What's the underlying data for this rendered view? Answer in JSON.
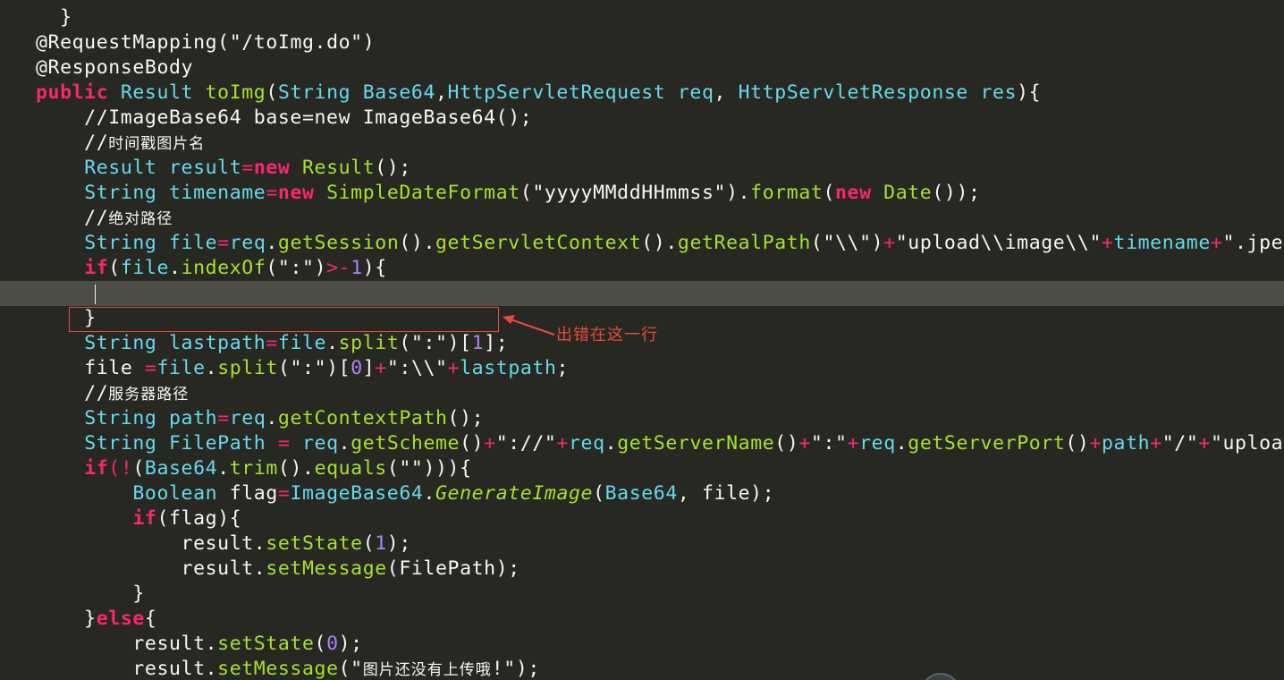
{
  "lines": [
    [
      {
        "t": "  }",
        "c": "text"
      }
    ],
    [
      {
        "t": "@RequestMapping(",
        "c": "text"
      },
      {
        "t": "\"/toImg.do\"",
        "c": "text"
      },
      {
        "t": ")",
        "c": "text"
      }
    ],
    [
      {
        "t": "@ResponseBody",
        "c": "text"
      }
    ],
    [
      {
        "t": "public",
        "c": "kw"
      },
      {
        "t": " ",
        "c": "text"
      },
      {
        "t": "Result",
        "c": "type"
      },
      {
        "t": " ",
        "c": "text"
      },
      {
        "t": "toImg",
        "c": "fn"
      },
      {
        "t": "(",
        "c": "text"
      },
      {
        "t": "String",
        "c": "type"
      },
      {
        "t": " ",
        "c": "text"
      },
      {
        "t": "Base64",
        "c": "type"
      },
      {
        "t": ",",
        "c": "text"
      },
      {
        "t": "HttpServletRequest",
        "c": "type"
      },
      {
        "t": " ",
        "c": "text"
      },
      {
        "t": "req",
        "c": "type"
      },
      {
        "t": ", ",
        "c": "text"
      },
      {
        "t": "HttpServletResponse",
        "c": "type"
      },
      {
        "t": " ",
        "c": "text"
      },
      {
        "t": "res",
        "c": "type"
      },
      {
        "t": "){",
        "c": "text"
      }
    ],
    [
      {
        "t": "    //ImageBase64 base=new ImageBase64();",
        "c": "comment"
      }
    ],
    [
      {
        "t": "    //",
        "c": "comment"
      },
      {
        "t": "时间戳图片名",
        "c": "comment",
        "cjk": true
      }
    ],
    [
      {
        "t": "    ",
        "c": "text"
      },
      {
        "t": "Result",
        "c": "type"
      },
      {
        "t": " ",
        "c": "text"
      },
      {
        "t": "result",
        "c": "type"
      },
      {
        "t": "=",
        "c": "op"
      },
      {
        "t": "new",
        "c": "kw"
      },
      {
        "t": " ",
        "c": "text"
      },
      {
        "t": "Result",
        "c": "fn"
      },
      {
        "t": "();",
        "c": "text"
      }
    ],
    [
      {
        "t": "    ",
        "c": "text"
      },
      {
        "t": "String",
        "c": "type"
      },
      {
        "t": " ",
        "c": "text"
      },
      {
        "t": "timename",
        "c": "type"
      },
      {
        "t": "=",
        "c": "op"
      },
      {
        "t": "new",
        "c": "kw"
      },
      {
        "t": " ",
        "c": "text"
      },
      {
        "t": "SimpleDateFormat",
        "c": "fn"
      },
      {
        "t": "(",
        "c": "text"
      },
      {
        "t": "\"yyyyMMddHHmmss\"",
        "c": "text"
      },
      {
        "t": ").",
        "c": "text"
      },
      {
        "t": "format",
        "c": "fn"
      },
      {
        "t": "(",
        "c": "text"
      },
      {
        "t": "new",
        "c": "kw"
      },
      {
        "t": " ",
        "c": "text"
      },
      {
        "t": "Date",
        "c": "fn"
      },
      {
        "t": "());",
        "c": "text"
      }
    ],
    [
      {
        "t": "    //",
        "c": "comment"
      },
      {
        "t": "绝对路径",
        "c": "comment",
        "cjk": true
      }
    ],
    [
      {
        "t": "    ",
        "c": "text"
      },
      {
        "t": "String",
        "c": "type"
      },
      {
        "t": " ",
        "c": "text"
      },
      {
        "t": "file",
        "c": "type"
      },
      {
        "t": "=",
        "c": "op"
      },
      {
        "t": "req",
        "c": "type"
      },
      {
        "t": ".",
        "c": "text"
      },
      {
        "t": "getSession",
        "c": "fn"
      },
      {
        "t": "().",
        "c": "text"
      },
      {
        "t": "getServletContext",
        "c": "fn"
      },
      {
        "t": "().",
        "c": "text"
      },
      {
        "t": "getRealPath",
        "c": "fn"
      },
      {
        "t": "(",
        "c": "text"
      },
      {
        "t": "\"\\\\\"",
        "c": "text"
      },
      {
        "t": ")",
        "c": "text"
      },
      {
        "t": "+",
        "c": "op"
      },
      {
        "t": "\"upload\\\\image\\\\\"",
        "c": "text"
      },
      {
        "t": "+",
        "c": "op"
      },
      {
        "t": "timename",
        "c": "type"
      },
      {
        "t": "+",
        "c": "op"
      },
      {
        "t": "\".jpeg\"",
        "c": "text"
      },
      {
        "t": ";",
        "c": "text"
      }
    ],
    [
      {
        "t": "    ",
        "c": "text"
      },
      {
        "t": "if",
        "c": "kw"
      },
      {
        "t": "(",
        "c": "text"
      },
      {
        "t": "file",
        "c": "type"
      },
      {
        "t": ".",
        "c": "text"
      },
      {
        "t": "indexOf",
        "c": "fn"
      },
      {
        "t": "(",
        "c": "text"
      },
      {
        "t": "\":\"",
        "c": "text"
      },
      {
        "t": ")",
        "c": "text"
      },
      {
        "t": ">-",
        "c": "op"
      },
      {
        "t": "1",
        "c": "num"
      },
      {
        "t": "){",
        "c": "text"
      }
    ],
    [
      {
        "t": "",
        "c": "text"
      }
    ],
    [
      {
        "t": "    }",
        "c": "text"
      }
    ],
    [
      {
        "t": "    ",
        "c": "text"
      },
      {
        "t": "String",
        "c": "type"
      },
      {
        "t": " ",
        "c": "text"
      },
      {
        "t": "lastpath",
        "c": "type"
      },
      {
        "t": "=",
        "c": "op"
      },
      {
        "t": "file",
        "c": "type"
      },
      {
        "t": ".",
        "c": "text"
      },
      {
        "t": "split",
        "c": "fn"
      },
      {
        "t": "(",
        "c": "text"
      },
      {
        "t": "\":\"",
        "c": "text"
      },
      {
        "t": ")[",
        "c": "text"
      },
      {
        "t": "1",
        "c": "num"
      },
      {
        "t": "];",
        "c": "text"
      }
    ],
    [
      {
        "t": "    ",
        "c": "text"
      },
      {
        "t": "file",
        "c": "text"
      },
      {
        "t": " ",
        "c": "text"
      },
      {
        "t": "=",
        "c": "op"
      },
      {
        "t": "file",
        "c": "type"
      },
      {
        "t": ".",
        "c": "text"
      },
      {
        "t": "split",
        "c": "fn"
      },
      {
        "t": "(",
        "c": "text"
      },
      {
        "t": "\":\"",
        "c": "text"
      },
      {
        "t": ")[",
        "c": "text"
      },
      {
        "t": "0",
        "c": "num"
      },
      {
        "t": "]",
        "c": "text"
      },
      {
        "t": "+",
        "c": "op"
      },
      {
        "t": "\":\\\\\"",
        "c": "text"
      },
      {
        "t": "+",
        "c": "op"
      },
      {
        "t": "lastpath",
        "c": "type"
      },
      {
        "t": ";",
        "c": "text"
      }
    ],
    [
      {
        "t": "    //",
        "c": "comment"
      },
      {
        "t": "服务器路径",
        "c": "comment",
        "cjk": true
      }
    ],
    [
      {
        "t": "    ",
        "c": "text"
      },
      {
        "t": "String",
        "c": "type"
      },
      {
        "t": " ",
        "c": "text"
      },
      {
        "t": "path",
        "c": "type"
      },
      {
        "t": "=",
        "c": "op"
      },
      {
        "t": "req",
        "c": "type"
      },
      {
        "t": ".",
        "c": "text"
      },
      {
        "t": "getContextPath",
        "c": "fn"
      },
      {
        "t": "();",
        "c": "text"
      }
    ],
    [
      {
        "t": "    ",
        "c": "text"
      },
      {
        "t": "String",
        "c": "type"
      },
      {
        "t": " ",
        "c": "text"
      },
      {
        "t": "FilePath",
        "c": "type"
      },
      {
        "t": " ",
        "c": "text"
      },
      {
        "t": "=",
        "c": "op"
      },
      {
        "t": " ",
        "c": "text"
      },
      {
        "t": "req",
        "c": "type"
      },
      {
        "t": ".",
        "c": "text"
      },
      {
        "t": "getScheme",
        "c": "fn"
      },
      {
        "t": "()",
        "c": "text"
      },
      {
        "t": "+",
        "c": "op"
      },
      {
        "t": "\"://\"",
        "c": "text"
      },
      {
        "t": "+",
        "c": "op"
      },
      {
        "t": "req",
        "c": "type"
      },
      {
        "t": ".",
        "c": "text"
      },
      {
        "t": "getServerName",
        "c": "fn"
      },
      {
        "t": "()",
        "c": "text"
      },
      {
        "t": "+",
        "c": "op"
      },
      {
        "t": "\":\"",
        "c": "text"
      },
      {
        "t": "+",
        "c": "op"
      },
      {
        "t": "req",
        "c": "type"
      },
      {
        "t": ".",
        "c": "text"
      },
      {
        "t": "getServerPort",
        "c": "fn"
      },
      {
        "t": "()",
        "c": "text"
      },
      {
        "t": "+",
        "c": "op"
      },
      {
        "t": "path",
        "c": "type"
      },
      {
        "t": "+",
        "c": "op"
      },
      {
        "t": "\"/\"",
        "c": "text"
      },
      {
        "t": "+",
        "c": "op"
      },
      {
        "t": "\"upload/ima",
        "c": "text"
      }
    ],
    [
      {
        "t": "    ",
        "c": "text"
      },
      {
        "t": "if",
        "c": "kw"
      },
      {
        "t": "(!",
        "c": "op"
      },
      {
        "t": "(",
        "c": "text"
      },
      {
        "t": "Base64",
        "c": "type"
      },
      {
        "t": ".",
        "c": "text"
      },
      {
        "t": "trim",
        "c": "fn"
      },
      {
        "t": "().",
        "c": "text"
      },
      {
        "t": "equals",
        "c": "fn"
      },
      {
        "t": "(",
        "c": "text"
      },
      {
        "t": "\"\"",
        "c": "text"
      },
      {
        "t": "))){",
        "c": "text"
      }
    ],
    [
      {
        "t": "        ",
        "c": "text"
      },
      {
        "t": "Boolean",
        "c": "type"
      },
      {
        "t": " ",
        "c": "text"
      },
      {
        "t": "flag",
        "c": "text"
      },
      {
        "t": "=",
        "c": "op"
      },
      {
        "t": "ImageBase64",
        "c": "type"
      },
      {
        "t": ".",
        "c": "text"
      },
      {
        "t": "GenerateImage",
        "c": "fn-i"
      },
      {
        "t": "(",
        "c": "text"
      },
      {
        "t": "Base64",
        "c": "type"
      },
      {
        "t": ", ",
        "c": "text"
      },
      {
        "t": "file",
        "c": "text"
      },
      {
        "t": ");",
        "c": "text"
      }
    ],
    [
      {
        "t": "        ",
        "c": "text"
      },
      {
        "t": "if",
        "c": "kw"
      },
      {
        "t": "(",
        "c": "text"
      },
      {
        "t": "flag",
        "c": "text"
      },
      {
        "t": "){",
        "c": "text"
      }
    ],
    [
      {
        "t": "            ",
        "c": "text"
      },
      {
        "t": "result",
        "c": "text"
      },
      {
        "t": ".",
        "c": "text"
      },
      {
        "t": "setState",
        "c": "fn"
      },
      {
        "t": "(",
        "c": "text"
      },
      {
        "t": "1",
        "c": "num"
      },
      {
        "t": ");",
        "c": "text"
      }
    ],
    [
      {
        "t": "            ",
        "c": "text"
      },
      {
        "t": "result",
        "c": "text"
      },
      {
        "t": ".",
        "c": "text"
      },
      {
        "t": "setMessage",
        "c": "fn"
      },
      {
        "t": "(",
        "c": "text"
      },
      {
        "t": "FilePath",
        "c": "text"
      },
      {
        "t": ");",
        "c": "text"
      }
    ],
    [
      {
        "t": "        }",
        "c": "text"
      }
    ],
    [
      {
        "t": "    }",
        "c": "text"
      },
      {
        "t": "else",
        "c": "kw"
      },
      {
        "t": "{",
        "c": "text"
      }
    ],
    [
      {
        "t": "        ",
        "c": "text"
      },
      {
        "t": "result",
        "c": "text"
      },
      {
        "t": ".",
        "c": "text"
      },
      {
        "t": "setState",
        "c": "fn"
      },
      {
        "t": "(",
        "c": "text"
      },
      {
        "t": "0",
        "c": "num"
      },
      {
        "t": ");",
        "c": "text"
      }
    ],
    [
      {
        "t": "        ",
        "c": "text"
      },
      {
        "t": "result",
        "c": "text"
      },
      {
        "t": ".",
        "c": "text"
      },
      {
        "t": "setMessage",
        "c": "fn"
      },
      {
        "t": "(",
        "c": "text"
      },
      {
        "t": "\"",
        "c": "text"
      },
      {
        "t": "图片还没有上传哦",
        "c": "text",
        "cjk": true
      },
      {
        "t": "!\"",
        "c": "text"
      },
      {
        "t": ");",
        "c": "text"
      }
    ],
    [
      {
        "t": "    }",
        "c": "text"
      }
    ]
  ],
  "annotation": {
    "label": "出错在这一行"
  },
  "colors": {
    "background": "#272822",
    "current_line": "#4d4d45",
    "annotation_red": "#e54b3c"
  }
}
